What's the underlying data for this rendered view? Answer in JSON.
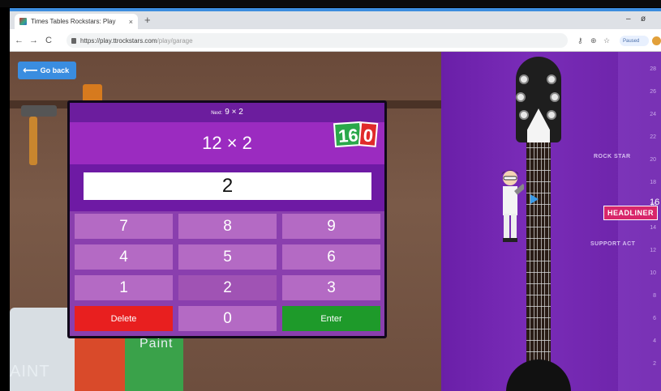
{
  "browser": {
    "tab_title": "Times Tables Rockstars: Play",
    "tab_close": "×",
    "new_tab": "+",
    "back": "←",
    "forward": "→",
    "reload": "C",
    "url_host": "https://play.ttrockstars.com",
    "url_path": "/play/garage",
    "paused_label": "Paused",
    "minimize": "–",
    "maximize": "ø"
  },
  "game": {
    "go_back_label": "Go back",
    "next_label": "Next:",
    "next_question": "9 × 2",
    "question": "12 × 2",
    "score_tens": "16",
    "score_units": "0",
    "answer_value": "2",
    "keypad": [
      "7",
      "8",
      "9",
      "4",
      "5",
      "6",
      "1",
      "2",
      "3",
      "Delete",
      "0",
      "Enter"
    ],
    "paint_label_1": "AINT",
    "paint_label_2": "Paint"
  },
  "stage": {
    "levels": [
      "28",
      "26",
      "24",
      "22",
      "20",
      "18",
      "16",
      "14",
      "12",
      "10",
      "8",
      "6",
      "4",
      "2"
    ],
    "rank_rock_star": "ROCK STAR",
    "rank_support_act": "SUPPORT ACT",
    "rank_headliner": "HEADLINER",
    "current_level": "16"
  },
  "colors": {
    "panel_purple": "#8a3fae",
    "question_purple": "#9b2bc0",
    "delete_red": "#e81f1f",
    "enter_green": "#1e9a2a",
    "stage_purple": "#6a1fa8",
    "go_back_blue": "#3a8de0"
  }
}
